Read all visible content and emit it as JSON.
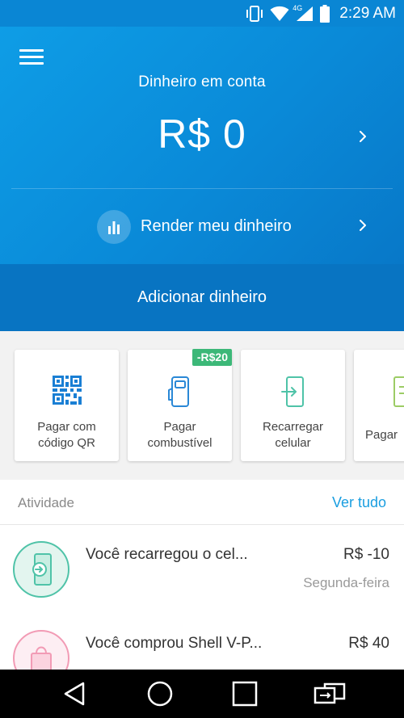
{
  "status_bar": {
    "time": "2:29 AM",
    "network": "4G",
    "icons": [
      "vibrate-icon",
      "wifi-icon",
      "signal-icon",
      "battery-icon"
    ]
  },
  "header": {
    "menu_icon": "hamburger-menu-icon",
    "balance_label": "Dinheiro em conta",
    "balance_value": "R$ 0",
    "render_label": "Render meu dinheiro",
    "render_icon": "bar-chart-icon",
    "add_money_label": "Adicionar dinheiro"
  },
  "quick_actions": [
    {
      "line1": "Pagar com",
      "line2": "código QR",
      "icon": "qr-code-icon",
      "badge": ""
    },
    {
      "line1": "Pagar",
      "line2": "combustível",
      "icon": "fuel-pump-icon",
      "badge": "-R$20"
    },
    {
      "line1": "Recarregar",
      "line2": "celular",
      "icon": "phone-recharge-icon",
      "badge": ""
    },
    {
      "line1": "Pagar",
      "line2": "",
      "icon": "bill-icon",
      "badge": ""
    }
  ],
  "activity": {
    "title": "Atividade",
    "see_all": "Ver tudo",
    "items": [
      {
        "title": "Você recarregou o cel...",
        "amount": "R$ -10",
        "date": "Segunda-feira",
        "icon": "phone-recharge-icon"
      },
      {
        "title": "Você comprou Shell V-P...",
        "amount": "R$ 40",
        "date": "",
        "icon": "shopping-bag-icon"
      }
    ]
  },
  "nav_bar": {
    "icons": [
      "back-icon",
      "home-icon",
      "recents-icon",
      "switch-app-icon"
    ]
  },
  "colors": {
    "primary": "#0a8ad8",
    "primary_dark": "#0874c2",
    "link": "#1a9ee0",
    "badge": "#3cb878",
    "qr_blue": "#1a7fd4",
    "teal": "#4fc3a8",
    "pink": "#f29bb5"
  }
}
